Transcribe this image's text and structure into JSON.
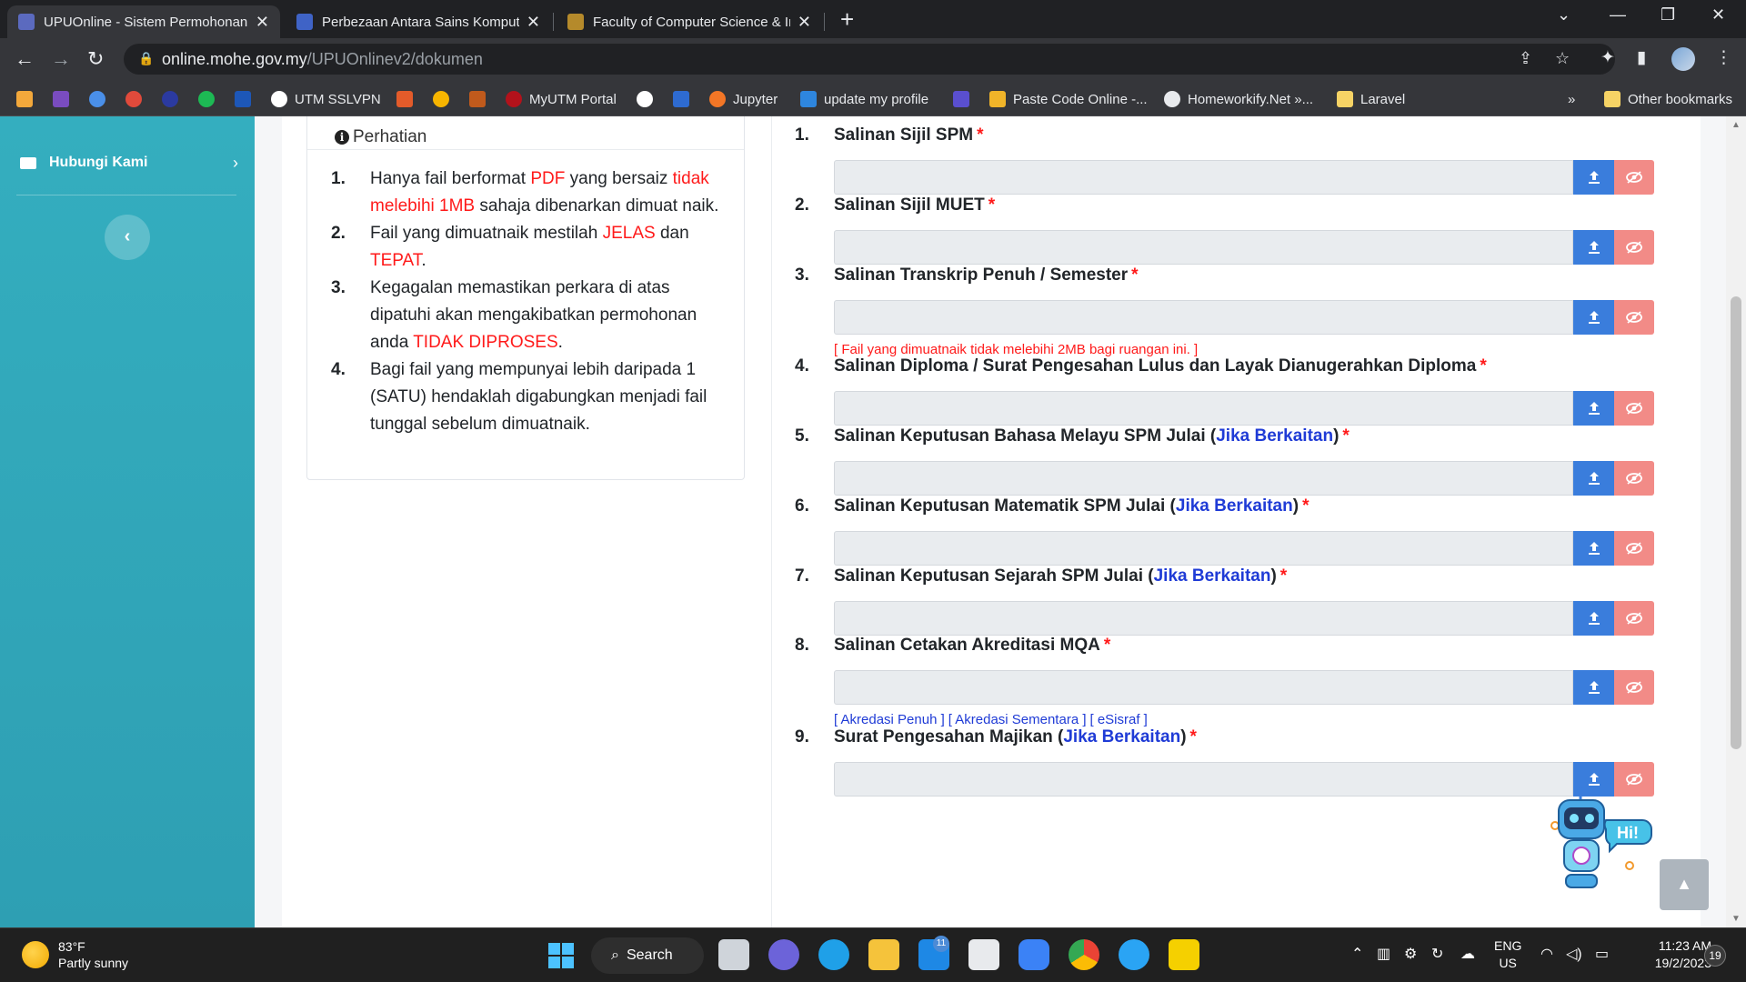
{
  "browser": {
    "tabs": [
      {
        "title": "UPUOnline - Sistem Permohonan",
        "active": true
      },
      {
        "title": "Perbezaan Antara Sains Komputer",
        "active": false
      },
      {
        "title": "Faculty of Computer Science & In",
        "active": false
      }
    ],
    "url_domain": "online.mohe.gov.my",
    "url_path": "/UPUOnlinev2/dokumen",
    "bookmarks": [
      {
        "label": "",
        "color": "#f3a83b"
      },
      {
        "label": "",
        "color": "#7a4cc0"
      },
      {
        "label": "",
        "color": "#4a8fe8"
      },
      {
        "label": "",
        "color": "#e14a3b"
      },
      {
        "label": "",
        "color": "#2b3aa0"
      },
      {
        "label": "",
        "color": "#1db954"
      },
      {
        "label": "",
        "color": "#1d57b8"
      },
      {
        "label": "UTM SSLVPN",
        "color": "#ffffff"
      },
      {
        "label": "",
        "color": "#e35b2a"
      },
      {
        "label": "",
        "color": "#f7b500"
      },
      {
        "label": "",
        "color": "#c05a1c"
      },
      {
        "label": "MyUTM Portal",
        "color": "#b3121b"
      },
      {
        "label": "",
        "color": "#ffffff"
      },
      {
        "label": "",
        "color": "#2e6bd1"
      },
      {
        "label": "Jupyter",
        "color": "#f37626"
      },
      {
        "label": "update my profile",
        "color": "#2e86de"
      },
      {
        "label": "",
        "color": "#5a4fcf"
      },
      {
        "label": "Paste Code Online -...",
        "color": "#f0b429"
      },
      {
        "label": "Homeworkify.Net »...",
        "color": "#e8eaed"
      },
      {
        "label": "Laravel",
        "color": "#f6d365"
      }
    ],
    "other_bookmarks": "Other bookmarks",
    "overflow": "»"
  },
  "sidebar": {
    "item_label": "Hubungi Kami"
  },
  "notice": {
    "title": "Perhatian",
    "items": [
      {
        "num": "1.",
        "parts": [
          {
            "t": "Hanya fail berformat ",
            "red": false
          },
          {
            "t": "PDF",
            "red": true
          },
          {
            "t": " yang bersaiz ",
            "red": false
          },
          {
            "t": "tidak melebihi 1MB",
            "red": true
          },
          {
            "t": " sahaja dibenarkan dimuat naik.",
            "red": false
          }
        ]
      },
      {
        "num": "2.",
        "parts": [
          {
            "t": "Fail yang dimuatnaik mestilah ",
            "red": false
          },
          {
            "t": "JELAS",
            "red": true
          },
          {
            "t": " dan ",
            "red": false
          },
          {
            "t": "TEPAT",
            "red": true
          },
          {
            "t": ".",
            "red": false
          }
        ]
      },
      {
        "num": "3.",
        "parts": [
          {
            "t": "Kegagalan memastikan perkara di atas dipatuhi akan mengakibatkan permohonan anda ",
            "red": false
          },
          {
            "t": "TIDAK DIPROSES",
            "red": true
          },
          {
            "t": ".",
            "red": false
          }
        ]
      },
      {
        "num": "4.",
        "parts": [
          {
            "t": "Bagi fail yang mempunyai lebih daripada 1 (SATU) hendaklah digabungkan menjadi fail tunggal sebelum dimuatnaik.",
            "red": false
          }
        ]
      }
    ]
  },
  "documents": [
    {
      "num": "1.",
      "label": "Salinan Sijil SPM",
      "optional": "",
      "note": "",
      "links": []
    },
    {
      "num": "2.",
      "label": "Salinan Sijil MUET",
      "optional": "",
      "note": "",
      "links": []
    },
    {
      "num": "3.",
      "label": "Salinan Transkrip Penuh / Semester",
      "optional": "",
      "note": "[ Fail yang dimuatnaik tidak melebihi 2MB bagi ruangan ini. ]",
      "links": []
    },
    {
      "num": "4.",
      "label": "Salinan Diploma / Surat Pengesahan Lulus dan Layak Dianugerahkan Diploma",
      "optional": "",
      "note": "",
      "links": []
    },
    {
      "num": "5.",
      "label": "Salinan Keputusan Bahasa Melayu SPM Julai",
      "optional": "Jika Berkaitan",
      "note": "",
      "links": []
    },
    {
      "num": "6.",
      "label": "Salinan Keputusan Matematik SPM Julai",
      "optional": "Jika Berkaitan",
      "note": "",
      "links": []
    },
    {
      "num": "7.",
      "label": "Salinan Keputusan Sejarah SPM Julai",
      "optional": "Jika Berkaitan",
      "note": "",
      "links": []
    },
    {
      "num": "8.",
      "label": "Salinan Cetakan Akreditasi MQA",
      "optional": "",
      "note": "",
      "links": [
        "[ Akredasi Penuh ]",
        "[ Akredasi Sementara ]",
        "[ eSisraf ]"
      ]
    },
    {
      "num": "9.",
      "label": "Surat Pengesahan Majikan",
      "optional": "Jika Berkaitan",
      "note": "",
      "links": []
    }
  ],
  "required_marker": "*",
  "mascot_text": "Hi!",
  "taskbar": {
    "temp": "83°F",
    "weather": "Partly sunny",
    "search": "Search",
    "mail_badge": "11",
    "lang_top": "ENG",
    "lang_bottom": "US",
    "time": "11:23 AM",
    "date": "19/2/2023",
    "notif_count": "19"
  },
  "colors": {
    "sidebar": "#34aebf",
    "upload_button": "#3a7ddc",
    "view_button": "#f28b87",
    "required": "#ff1a1a",
    "optional_link": "#1f3bd6"
  }
}
